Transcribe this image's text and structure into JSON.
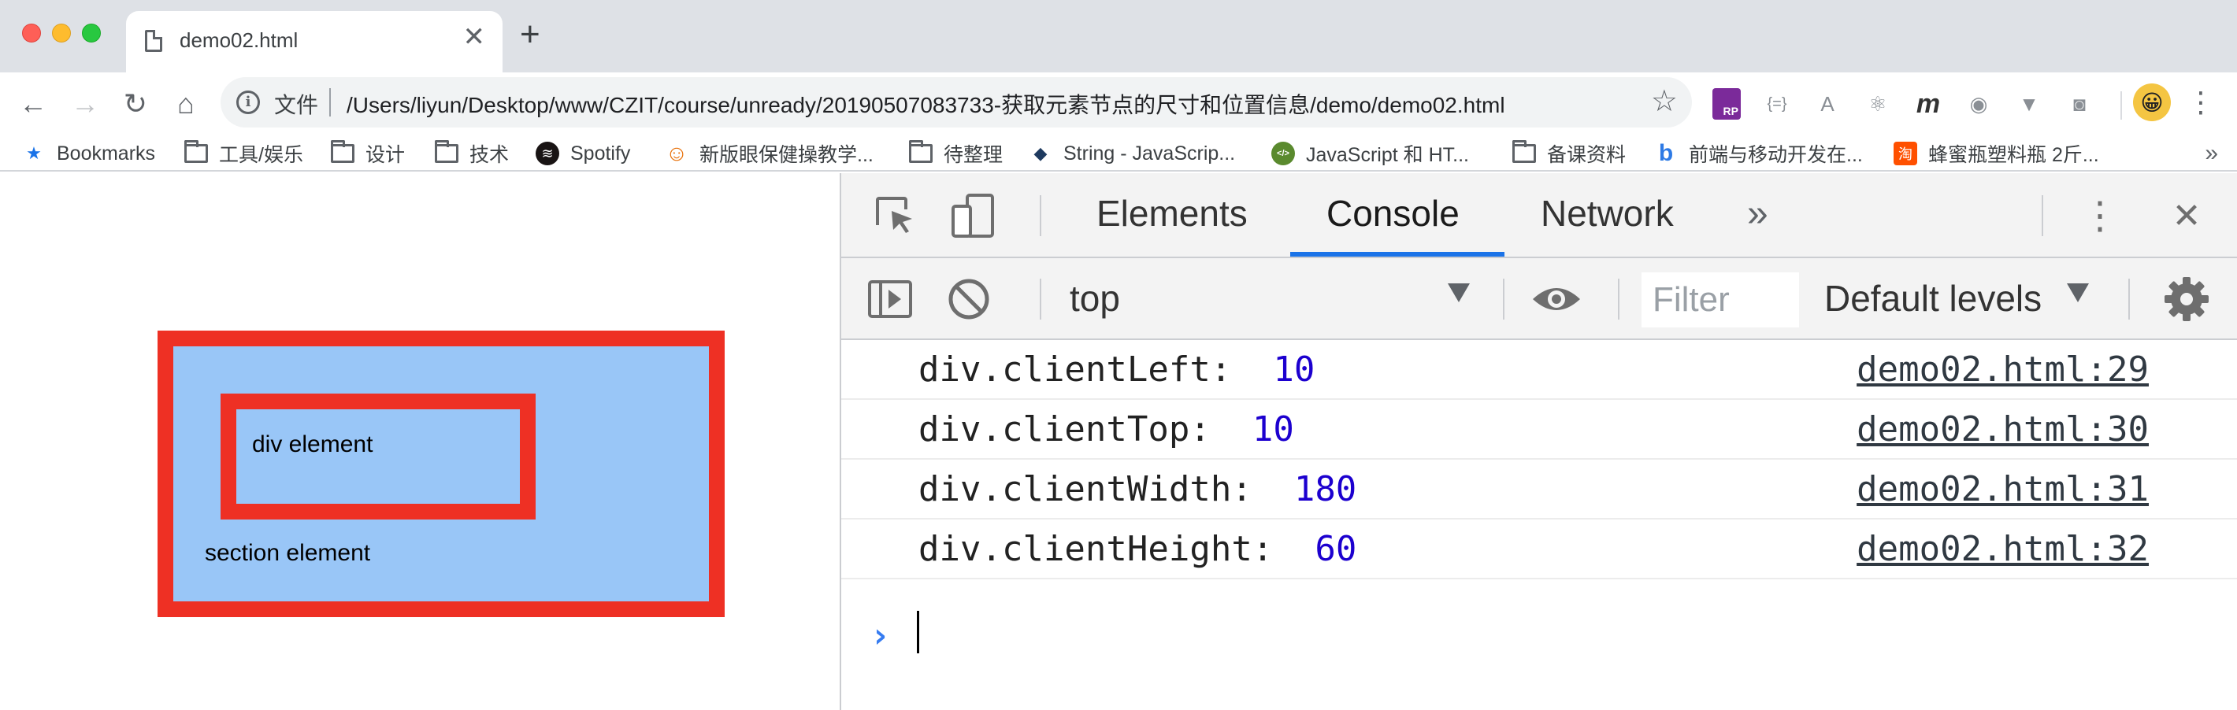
{
  "browser": {
    "tab": {
      "title": "demo02.html",
      "close_glyph": "✕",
      "icon": "document-icon"
    },
    "new_tab_glyph": "+",
    "nav": {
      "back_glyph": "←",
      "forward_glyph": "→",
      "reload_glyph": "↻",
      "home_glyph": "⌂"
    },
    "address": {
      "security_label": "文件",
      "url": "/Users/liyun/Desktop/www/CZIT/course/unready/20190507083733-获取元素节点的尺寸和位置信息/demo/demo02.html",
      "star_glyph": "☆"
    },
    "extensions": [
      {
        "name": "axure-rp-extension-icon",
        "glyph": "RP"
      },
      {
        "name": "json-viewer-extension-icon",
        "glyph": "{=}"
      },
      {
        "name": "angular-extension-icon",
        "glyph": "A"
      },
      {
        "name": "react-extension-icon",
        "glyph": "⚛"
      },
      {
        "name": "m-extension-icon",
        "glyph": "m"
      },
      {
        "name": "globe-extension-icon",
        "glyph": "◉"
      },
      {
        "name": "vue-extension-icon",
        "glyph": "▼"
      },
      {
        "name": "camera-extension-icon",
        "glyph": "◙"
      }
    ],
    "avatar_glyph": "😀",
    "menu_glyph": "⋮"
  },
  "bookmarks": [
    {
      "label": "Bookmarks",
      "icon": "star-icon",
      "glyph": "★",
      "color": "#1a73e8"
    },
    {
      "label": "工具/娱乐",
      "icon": "folder-icon"
    },
    {
      "label": "设计",
      "icon": "folder-icon"
    },
    {
      "label": "技术",
      "icon": "folder-icon"
    },
    {
      "label": "Spotify",
      "icon": "spotify-icon",
      "glyph": "≋",
      "color": "#191414"
    },
    {
      "label": "新版眼保健操教学...",
      "icon": "face-icon",
      "glyph": "☺",
      "color": "#e8710a"
    },
    {
      "label": "待整理",
      "icon": "folder-icon"
    },
    {
      "label": "String - JavaScrip...",
      "icon": "mdn-icon",
      "glyph": "◆",
      "color": "#1e3a5f"
    },
    {
      "label": "JavaScript 和 HT...",
      "icon": "code-icon",
      "glyph": "</>",
      "color": "#5a8a2e"
    },
    {
      "label": "备课资料",
      "icon": "folder-icon"
    },
    {
      "label": "前端与移动开发在...",
      "icon": "b-icon",
      "glyph": "b",
      "color": "#2d7ae5"
    },
    {
      "label": "蜂蜜瓶塑料瓶 2斤...",
      "icon": "taobao-icon",
      "glyph": "淘",
      "color": "#ff5000"
    }
  ],
  "bookmarks_more": "»",
  "page": {
    "div_label": "div element",
    "section_label": "section element"
  },
  "devtools": {
    "tabs": [
      {
        "label": "Elements",
        "active": false
      },
      {
        "label": "Console",
        "active": true
      },
      {
        "label": "Network",
        "active": false
      }
    ],
    "more_tabs_glyph": "»",
    "kebab_glyph": "⋮",
    "close_glyph": "✕",
    "context": "top",
    "filter_placeholder": "Filter",
    "levels": "Default levels",
    "accent": "#1a73e8",
    "logs": [
      {
        "label": "div.clientLeft:",
        "value": "10",
        "source": "demo02.html:29"
      },
      {
        "label": "div.clientTop:",
        "value": "10",
        "source": "demo02.html:30"
      },
      {
        "label": "div.clientWidth:",
        "value": "180",
        "source": "demo02.html:31"
      },
      {
        "label": "div.clientHeight:",
        "value": "60",
        "source": "demo02.html:32"
      }
    ],
    "prompt_glyph": "›"
  }
}
